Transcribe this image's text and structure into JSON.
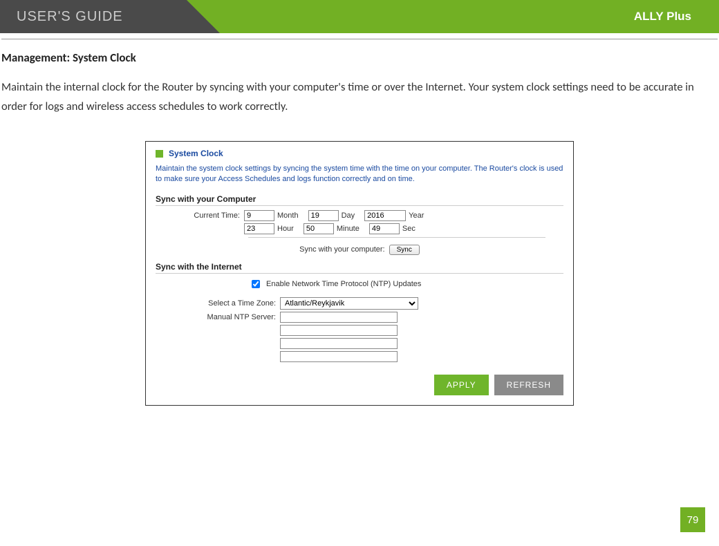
{
  "header": {
    "guide_label": "USER'S GUIDE",
    "product": "ALLY Plus"
  },
  "section": {
    "title": "Management: System Clock",
    "description": "Maintain the internal clock for the Router by syncing with your computer's time or over the Internet. Your system clock settings need to be accurate in order for logs and wireless access schedules to work correctly."
  },
  "panel": {
    "title": "System Clock",
    "desc": "Maintain the system clock settings by syncing the system time with the time on your computer. The Router's clock is used to make sure your Access Schedules and logs function correctly and on time.",
    "sync_computer_heading": "Sync with your Computer",
    "current_time_label": "Current Time:",
    "month": "9",
    "month_unit": "Month",
    "day": "19",
    "day_unit": "Day",
    "year": "2016",
    "year_unit": "Year",
    "hour": "23",
    "hour_unit": "Hour",
    "minute": "50",
    "minute_unit": "Minute",
    "second": "49",
    "second_unit": "Sec",
    "sync_with_computer_label": "Sync with your computer:",
    "sync_button": "Sync",
    "sync_internet_heading": "Sync with the Internet",
    "ntp_enable_label": "Enable Network Time Protocol (NTP) Updates",
    "tz_label": "Select a Time Zone:",
    "tz_value": "Atlantic/Reykjavik",
    "ntp_server_label": "Manual NTP Server:",
    "apply": "APPLY",
    "refresh": "REFRESH"
  },
  "page_number": "79"
}
